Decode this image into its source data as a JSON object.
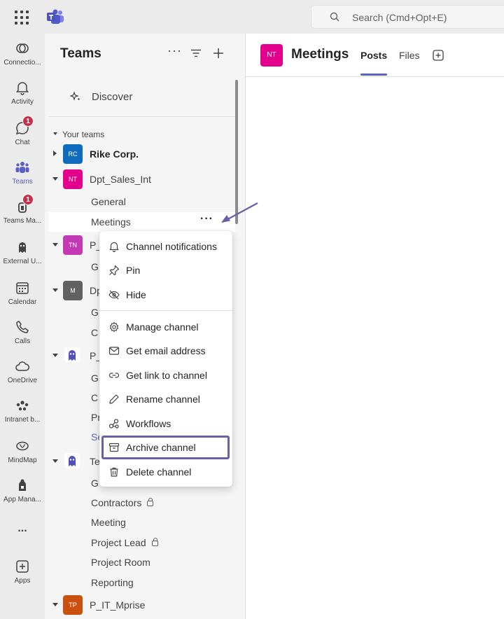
{
  "search": {
    "placeholder": "Search (Cmd+Opt+E)"
  },
  "rail": [
    {
      "label": "Connectio...",
      "icon": "connections-icon"
    },
    {
      "label": "Activity",
      "icon": "bell-icon"
    },
    {
      "label": "Chat",
      "icon": "chat-icon",
      "badge": "1"
    },
    {
      "label": "Teams",
      "icon": "teams-icon",
      "active": true
    },
    {
      "label": "Teams Ma...",
      "icon": "teams-manager-icon",
      "badge": "1"
    },
    {
      "label": "External U...",
      "icon": "external-icon"
    },
    {
      "label": "Calendar",
      "icon": "calendar-icon"
    },
    {
      "label": "Calls",
      "icon": "phone-icon"
    },
    {
      "label": "OneDrive",
      "icon": "cloud-icon"
    },
    {
      "label": "Intranet b...",
      "icon": "intranet-icon"
    },
    {
      "label": "MindMap",
      "icon": "mindmap-icon"
    },
    {
      "label": "App Mana...",
      "icon": "app-manager-icon"
    },
    {
      "label": "...",
      "icon": "more-icon"
    },
    {
      "label": "Apps",
      "icon": "plus-square-icon"
    }
  ],
  "panel": {
    "title": "Teams",
    "discover": "Discover",
    "section": "Your teams",
    "teams": [
      {
        "avatar": "RC",
        "name": "Rike Corp.",
        "color": "#0f6cbd"
      },
      {
        "avatar": "NT",
        "name": "Dpt_Sales_Int",
        "color": "#e3008c"
      },
      {
        "avatar": "TN",
        "name": "P_",
        "color": "#c239b3"
      },
      {
        "avatar": "M",
        "name": "Dp",
        "color": "#616161"
      },
      {
        "name": "P_"
      },
      {
        "name": "Te"
      },
      {
        "avatar": "TP",
        "name": "P_IT_Mprise",
        "color": "#ca5010"
      }
    ],
    "channels": {
      "sales": [
        "General",
        "Meetings"
      ],
      "p_partial": [
        "G"
      ],
      "dp_partial": [
        "G",
        "C"
      ],
      "p2_partial": [
        "G",
        "C",
        "Pr",
        "Se"
      ],
      "te_partial": [
        "G"
      ],
      "te": [
        "Contractors",
        "Meeting",
        "Project Lead",
        "Project Room",
        "Reporting"
      ]
    }
  },
  "main": {
    "avatar": "NT",
    "title": "Meetings",
    "tabs": [
      "Posts",
      "Files"
    ]
  },
  "menu": [
    {
      "label": "Channel notifications",
      "icon": "bell-icon"
    },
    {
      "label": "Pin",
      "icon": "pin-icon"
    },
    {
      "label": "Hide",
      "icon": "eye-off-icon"
    },
    {
      "label": "Manage channel",
      "icon": "gear-icon"
    },
    {
      "label": "Get email address",
      "icon": "mail-icon"
    },
    {
      "label": "Get link to channel",
      "icon": "link-icon"
    },
    {
      "label": "Rename channel",
      "icon": "pencil-icon"
    },
    {
      "label": "Workflows",
      "icon": "workflows-icon"
    },
    {
      "label": "Archive channel",
      "icon": "archive-icon"
    },
    {
      "label": "Delete channel",
      "icon": "trash-icon"
    }
  ],
  "colors": {
    "accent": "#5b5fc7",
    "highlight": "#6b5fa8",
    "badge": "#c4314b"
  }
}
